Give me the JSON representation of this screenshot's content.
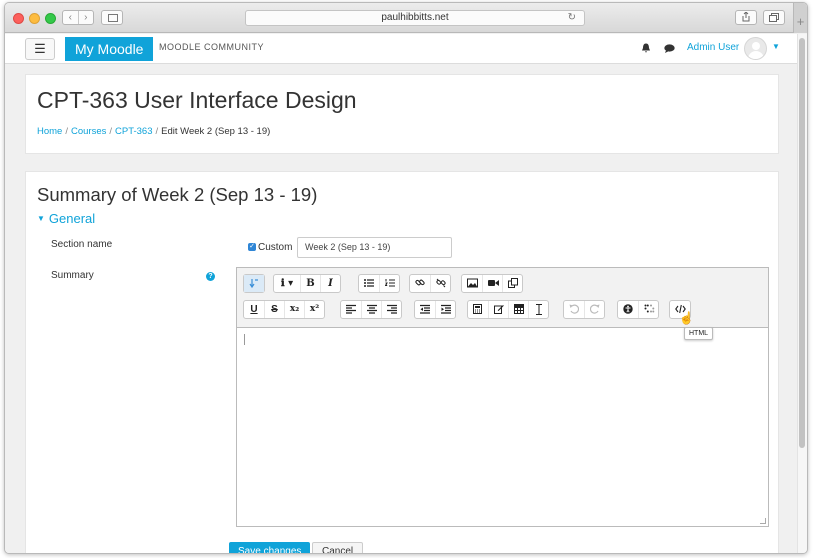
{
  "browser": {
    "url": "paulhibbitts.net"
  },
  "navbar": {
    "menu_icon": "☰",
    "brand": "My Moodle",
    "community": "MOODLE COMMUNITY",
    "username": "Admin User",
    "accent": "#10a3d9"
  },
  "header": {
    "course_title": "CPT-363 User Interface Design",
    "breadcrumb": {
      "home": "Home",
      "courses": "Courses",
      "course": "CPT-363",
      "current": "Edit Week 2 (Sep 13 - 19)",
      "separator": "/"
    }
  },
  "form": {
    "title": "Summary of Week 2 (Sep 13 - 19)",
    "legend": "General",
    "section_name_label": "Section name",
    "custom_label": "Custom",
    "custom_checked": true,
    "section_name_value": "Week 2 (Sep 13 - 19)",
    "summary_label": "Summary",
    "help_icon": "?",
    "save_label": "Save changes",
    "cancel_label": "Cancel"
  },
  "editor": {
    "toolbar": {
      "bold": "B",
      "italic": "I",
      "underline": "U",
      "strike": "S",
      "subscript": "x₂",
      "superscript": "x²",
      "info": "ℹ ▾"
    },
    "tooltip": "HTML"
  }
}
